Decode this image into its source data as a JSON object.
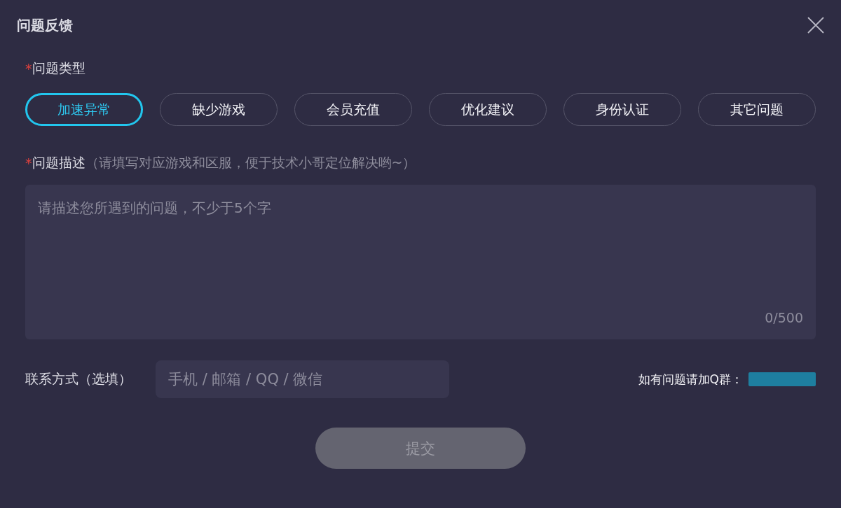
{
  "window": {
    "title": "问题反馈"
  },
  "type_section": {
    "required_mark": "*",
    "label": "问题类型"
  },
  "types": [
    {
      "label": "加速异常",
      "selected": true
    },
    {
      "label": "缺少游戏",
      "selected": false
    },
    {
      "label": "会员充值",
      "selected": false
    },
    {
      "label": "优化建议",
      "selected": false
    },
    {
      "label": "身份认证",
      "selected": false
    },
    {
      "label": "其它问题",
      "selected": false
    }
  ],
  "description": {
    "required_mark": "*",
    "label": "问题描述",
    "hint": "（请填写对应游戏和区服，便于技术小哥定位解决哟~）",
    "placeholder": "请描述您所遇到的问题，不少于5个字",
    "counter": "0/500"
  },
  "contact": {
    "label": "联系方式（选填）",
    "placeholder": "手机 / 邮箱 / QQ / 微信"
  },
  "group": {
    "text": "如有问题请加Q群："
  },
  "submit": {
    "label": "提交",
    "disabled": true
  }
}
